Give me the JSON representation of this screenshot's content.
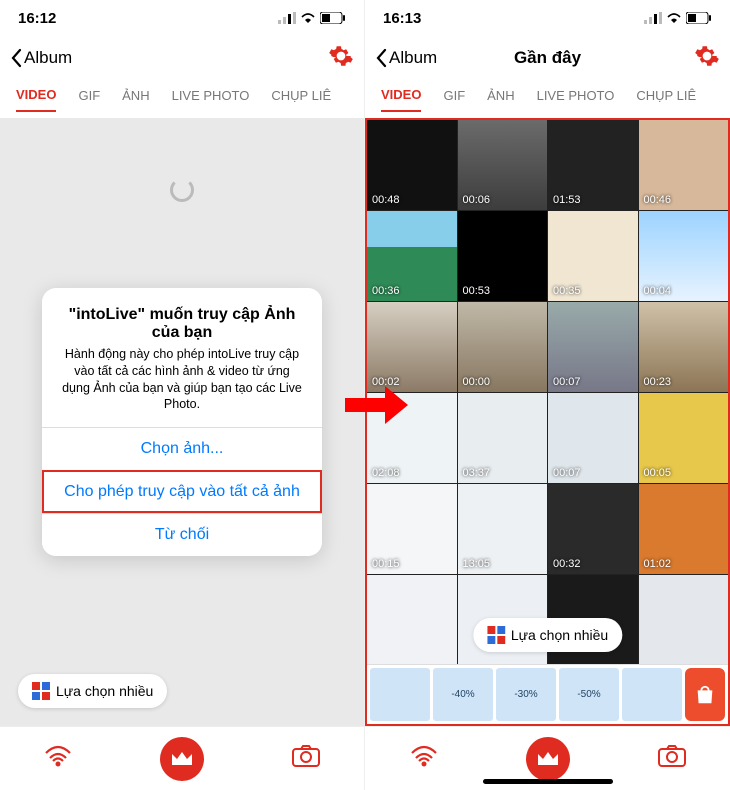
{
  "colors": {
    "accent": "#e02b20",
    "ios_blue": "#007aff"
  },
  "left": {
    "status": {
      "time": "16:12"
    },
    "nav": {
      "back": "Album"
    },
    "tabs": [
      "VIDEO",
      "GIF",
      "ẢNH",
      "LIVE PHOTO",
      "CHỤP LIÊ"
    ],
    "active_tab": 0,
    "alert": {
      "title": "\"intoLive\" muốn truy cập Ảnh của bạn",
      "body": "Hành động này cho phép intoLive truy cập vào tất cả các hình ảnh & video từ ứng dụng Ảnh của bạn và giúp bạn tạo các Live Photo.",
      "buttons": [
        "Chọn ảnh...",
        "Cho phép truy cập vào tất cả ảnh",
        "Từ chối"
      ],
      "highlight_index": 1
    },
    "multi_select": "Lựa chọn nhiều"
  },
  "right": {
    "status": {
      "time": "16:13"
    },
    "nav": {
      "back": "Album",
      "title": "Gần đây"
    },
    "tabs": [
      "VIDEO",
      "GIF",
      "ẢNH",
      "LIVE PHOTO",
      "CHỤP LIÊ"
    ],
    "active_tab": 0,
    "multi_select": "Lựa chọn nhiều",
    "videos": [
      {
        "dur": "00:48"
      },
      {
        "dur": "00:06"
      },
      {
        "dur": "01:53"
      },
      {
        "dur": "00:46"
      },
      {
        "dur": "00:36"
      },
      {
        "dur": "00:53"
      },
      {
        "dur": "00:35"
      },
      {
        "dur": "00:04"
      },
      {
        "dur": "00:02"
      },
      {
        "dur": "00:00"
      },
      {
        "dur": "00:07"
      },
      {
        "dur": "00:23"
      },
      {
        "dur": "02:08"
      },
      {
        "dur": "03:37"
      },
      {
        "dur": "00:07"
      },
      {
        "dur": "00:05"
      },
      {
        "dur": "00:15"
      },
      {
        "dur": "13:05"
      },
      {
        "dur": "00:32"
      },
      {
        "dur": "01:02"
      },
      {
        "dur": ""
      },
      {
        "dur": ""
      },
      {
        "dur": ""
      },
      {
        "dur": ""
      }
    ],
    "ad_badges": [
      "",
      "-40%",
      "-30%",
      "-50%",
      ""
    ]
  }
}
